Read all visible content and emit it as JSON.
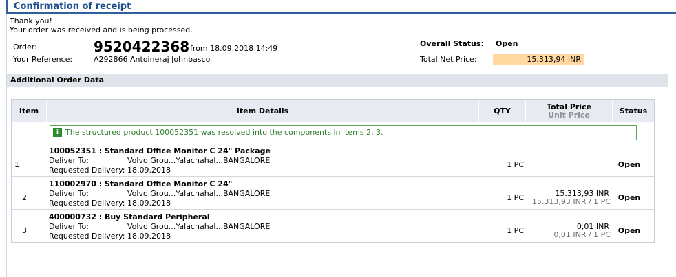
{
  "header": {
    "title": "Confirmation of receipt"
  },
  "message": {
    "line1": "Thank you!",
    "line2": "Your order was received and is being processed."
  },
  "order": {
    "order_label": "Order:",
    "order_number": "9520422368",
    "order_from": "from 18.09.2018 14:49",
    "reference_label": "Your Reference:",
    "reference_value": "A292866 Antoineraj Johnbasco",
    "status_label": "Overall Status:",
    "status_value": "Open",
    "net_price_label": "Total Net Price:",
    "net_price_value": "15.313,94 INR"
  },
  "section": {
    "title": "Additional Order Data"
  },
  "table": {
    "headers": {
      "item": "Item",
      "details": "Item Details",
      "qty": "QTY",
      "total_price": "Total Price",
      "unit_price": "Unit Price",
      "status": "Status"
    },
    "info_message": "The structured product 100052351 was resolved into the components in items 2, 3.",
    "rows": [
      {
        "item": "1",
        "title": "100052351 : Standard Office Monitor C 24\" Package",
        "deliver_label": "Deliver To:",
        "deliver_value": "Volvo Grou...Yalachahal...BANGALORE",
        "delivery_label": "Requested Delivery:",
        "delivery_value": "18.09.2018",
        "qty": "1 PC",
        "total": "",
        "unit": "",
        "status": "Open"
      },
      {
        "item": "2",
        "title": "110002970 : Standard Office Monitor C 24\"",
        "deliver_label": "Deliver To:",
        "deliver_value": "Volvo Grou...Yalachahal...BANGALORE",
        "delivery_label": "Requested Delivery:",
        "delivery_value": "18.09.2018",
        "qty": "1 PC",
        "total": "15.313,93 INR",
        "unit": "15.313,93 INR / 1 PC",
        "status": "Open"
      },
      {
        "item": "3",
        "title": "400000732 : Buy Standard Peripheral",
        "deliver_label": "Deliver To:",
        "deliver_value": "Volvo Grou...Yalachahal...BANGALORE",
        "delivery_label": "Requested Delivery:",
        "delivery_value": "18.09.2018",
        "qty": "1 PC",
        "total": "0,01 INR",
        "unit": "0,01 INR / 1 PC",
        "status": "Open"
      }
    ]
  },
  "colors": {
    "title": "#1f4f8f",
    "highlight": "#ffd9a0",
    "info_green": "#2e7d2e",
    "section_bg": "#dfe3ea"
  }
}
